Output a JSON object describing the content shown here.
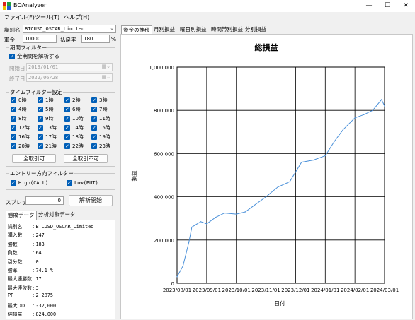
{
  "window": {
    "title": "BOAnalyzer",
    "controls": [
      "—",
      "☐",
      "✕"
    ]
  },
  "menu": [
    "ファイル(F)",
    "ツール(T)",
    "ヘルプ(H)"
  ],
  "symbol": {
    "label": "識別名",
    "value": "BTCUSD_OSCAR_Limited"
  },
  "funds": {
    "label": "軍金",
    "value": "10000"
  },
  "payout": {
    "label": "払戻率",
    "value": "180",
    "unit": "%"
  },
  "period": {
    "title": "期間フィルター",
    "all_label": "全期間を解析する",
    "start_label": "開始日",
    "start_value": "2019/01/01",
    "end_label": "終了日",
    "end_value": "2022/06/28"
  },
  "time_filter": {
    "title": "タイムフィルター設定",
    "hours": [
      "0時",
      "1時",
      "2時",
      "3時",
      "4時",
      "5時",
      "6時",
      "7時",
      "8時",
      "9時",
      "10時",
      "11時",
      "12時",
      "13時",
      "14時",
      "15時",
      "16時",
      "17時",
      "18時",
      "19時",
      "20時",
      "21時",
      "22時",
      "23時"
    ],
    "select_all": "全取引可",
    "deselect_all": "全取引不可"
  },
  "entry_filter": {
    "title": "エントリー方向フィルター",
    "high": "High(CALL)",
    "low": "Low(PUT)"
  },
  "spread": {
    "label": "スプレッド",
    "value": "0"
  },
  "start_button": "解析開始",
  "data_tabs": [
    "勝敗データ",
    "分析対象データ"
  ],
  "stats": [
    {
      "k": "識別名",
      "v": "BTCUSD_OSCAR_Limited"
    },
    {
      "k": "購入数",
      "v": "247"
    },
    {
      "k": "勝数",
      "v": "183"
    },
    {
      "k": "負数",
      "v": "64"
    },
    {
      "k": "引分数",
      "v": "0"
    },
    {
      "k": "勝率",
      "v": "74.1 %"
    },
    {
      "k": "最大連勝数",
      "v": "17"
    },
    {
      "k": "最大連敗数",
      "v": "3"
    },
    {
      "k": "PF",
      "v": "2.2875"
    },
    {
      "k": "最大DD",
      "v": "-32,000"
    },
    {
      "k": "純損益",
      "v": "824,000"
    }
  ],
  "chart_tabs": [
    "資金の推移",
    "月別損益",
    "曜日別損益",
    "時間帯別損益",
    "分別損益"
  ],
  "chart_data": {
    "type": "line",
    "title": "総損益",
    "xlabel": "日付",
    "ylabel": "損益",
    "x_ticks": [
      "2023/08/01",
      "2023/09/01",
      "2023/10/01",
      "2023/11/01",
      "2023/12/01",
      "2024/01/01",
      "2024/02/01",
      "2024/03/01"
    ],
    "y_ticks": [
      "0",
      "200,000",
      "400,000",
      "600,000",
      "800,000",
      "1,000,000"
    ],
    "ylim": [
      0,
      1000000
    ],
    "grid": true,
    "color": "#4a90d9",
    "x": [
      0,
      0.2,
      0.4,
      0.5,
      0.8,
      1,
      1.3,
      1.6,
      2,
      2.3,
      2.6,
      3,
      3.4,
      3.8,
      4.2,
      4.6,
      5,
      5.3,
      5.6,
      6,
      6.3,
      6.6,
      6.9,
      7
    ],
    "values": [
      30000,
      80000,
      190000,
      260000,
      285000,
      275000,
      305000,
      325000,
      320000,
      330000,
      360000,
      400000,
      445000,
      470000,
      560000,
      570000,
      590000,
      655000,
      710000,
      765000,
      780000,
      800000,
      850000,
      820000
    ]
  }
}
